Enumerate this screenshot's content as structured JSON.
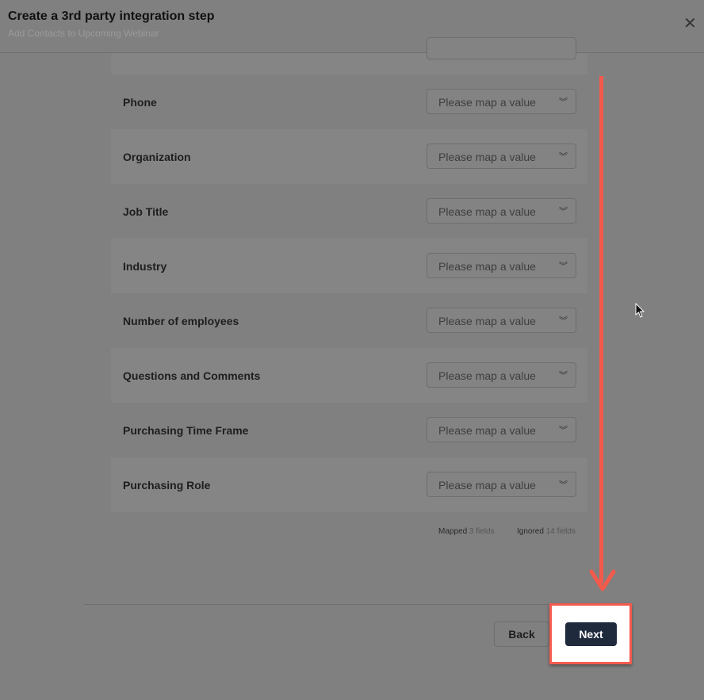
{
  "header": {
    "title": "Create a 3rd party integration step",
    "subtitle": "Add Contacts to Upcoming Webinar",
    "close_icon": "close-icon"
  },
  "placeholder": "Please map a value",
  "fields": [
    {
      "label": "Phone"
    },
    {
      "label": "Organization"
    },
    {
      "label": "Job Title"
    },
    {
      "label": "Industry"
    },
    {
      "label": "Number of employees"
    },
    {
      "label": "Questions and Comments"
    },
    {
      "label": "Purchasing Time Frame"
    },
    {
      "label": "Purchasing Role"
    }
  ],
  "summary": {
    "mapped_label": "Mapped",
    "mapped_value": "3 fields",
    "ignored_label": "Ignored",
    "ignored_value": "14 fields"
  },
  "footer": {
    "back": "Back",
    "next": "Next"
  },
  "colors": {
    "annotation": "#f45a4c",
    "primary": "#1f2a3d"
  }
}
